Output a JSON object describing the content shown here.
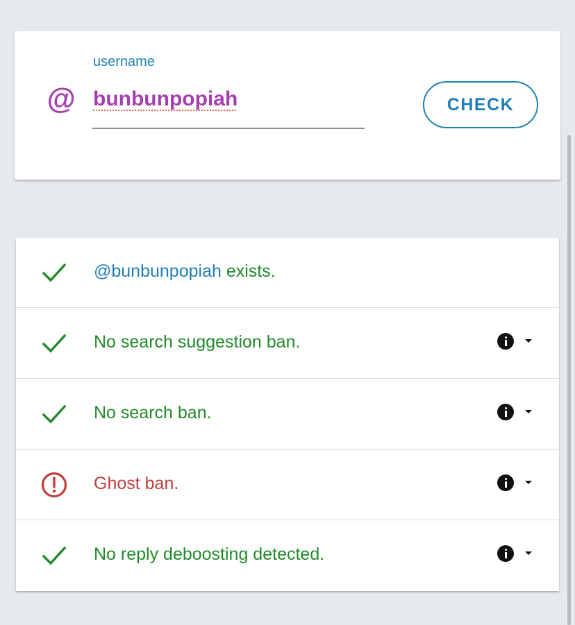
{
  "form": {
    "at_symbol": "@",
    "label": "username",
    "value": "bunbunpopiah",
    "check_label": "CHECK",
    "accent_color": "#1f7fb4",
    "handle_color": "#a53fb0"
  },
  "results": [
    {
      "status": "ok",
      "icon": "check-icon",
      "handle": "@bunbunpopiah",
      "text": " exists.",
      "has_info": false
    },
    {
      "status": "ok",
      "icon": "check-icon",
      "text": "No search suggestion ban.",
      "has_info": true
    },
    {
      "status": "ok",
      "icon": "check-icon",
      "text": "No search ban.",
      "has_info": true
    },
    {
      "status": "error",
      "icon": "alert-circle-icon",
      "text": "Ghost ban.",
      "has_info": true
    },
    {
      "status": "ok",
      "icon": "check-icon",
      "text": "No reply deboosting detected.",
      "has_info": true
    }
  ],
  "colors": {
    "ok": "#228a2a",
    "error": "#c23c3c",
    "background": "#e6eaee"
  }
}
